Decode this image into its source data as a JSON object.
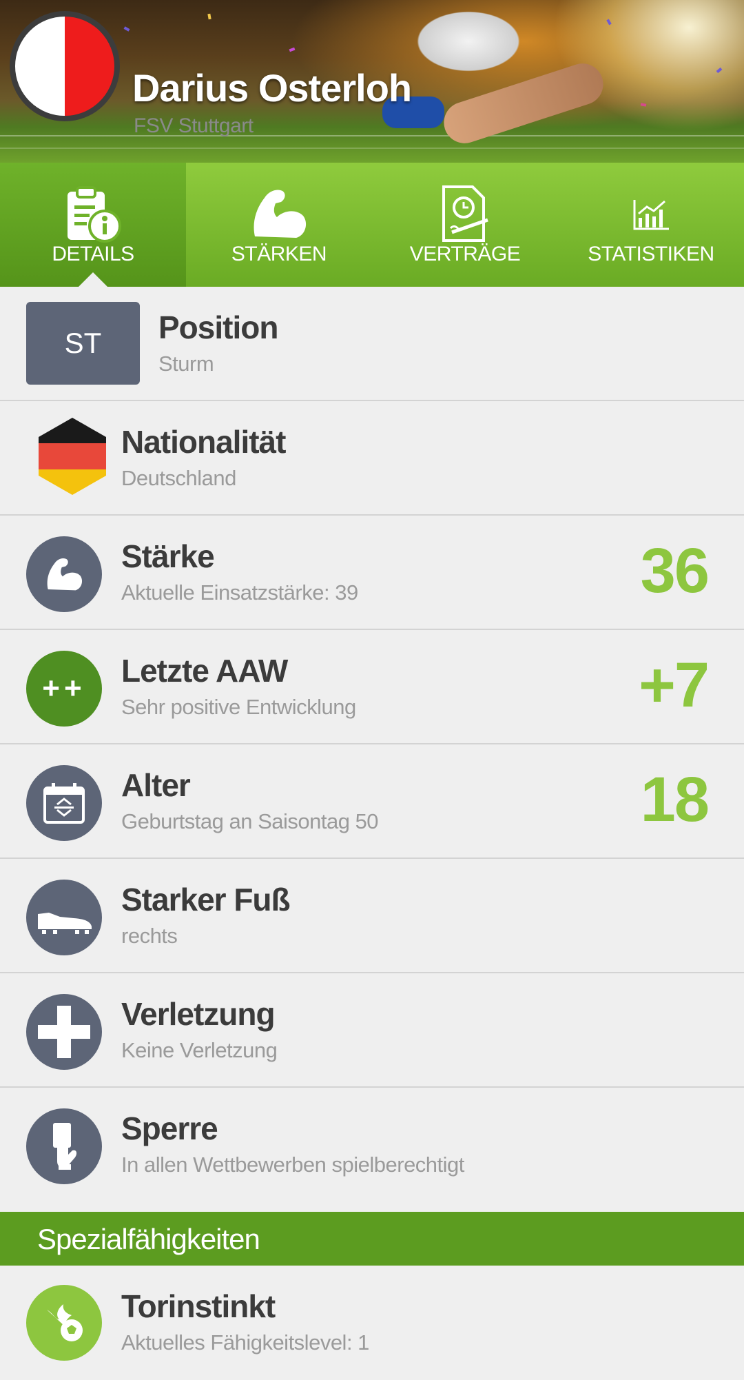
{
  "header": {
    "player_name": "Darius Osterloh",
    "club_name": "FSV Stuttgart",
    "club_colors": [
      "#ffffff",
      "#ee1c1c"
    ]
  },
  "tabs": [
    {
      "label": "DETAILS",
      "icon": "clipboard-info-icon",
      "active": true
    },
    {
      "label": "STÄRKEN",
      "icon": "biceps-icon",
      "active": false
    },
    {
      "label": "VERTRÄGE",
      "icon": "contract-clock-icon",
      "active": false
    },
    {
      "label": "STATISTIKEN",
      "icon": "bar-chart-icon",
      "active": false
    }
  ],
  "details": {
    "position": {
      "badge": "ST",
      "title": "Position",
      "subtitle": "Sturm"
    },
    "nationality": {
      "title": "Nationalität",
      "subtitle": "Deutschland",
      "icon": "germany-flag-icon"
    },
    "strength": {
      "title": "Stärke",
      "subtitle": "Aktuelle Einsatzstärke: 39",
      "value": "36",
      "icon": "biceps-icon"
    },
    "last_aaw": {
      "title": "Letzte AAW",
      "subtitle": "Sehr positive Entwicklung",
      "value": "+7",
      "badge": "++"
    },
    "age": {
      "title": "Alter",
      "subtitle": "Geburtstag an Saisontag 50",
      "value": "18",
      "icon": "calendar-icon"
    },
    "strong_foot": {
      "title": "Starker Fuß",
      "subtitle": "rechts",
      "icon": "football-boot-icon"
    },
    "injury": {
      "title": "Verletzung",
      "subtitle": "Keine Verletzung",
      "icon": "medical-cross-icon"
    },
    "suspension": {
      "title": "Sperre",
      "subtitle": "In allen Wettbewerben spielberechtigt",
      "icon": "card-hand-icon"
    }
  },
  "special_abilities": {
    "section_title": "Spezialfähigkeiten",
    "items": [
      {
        "title": "Torinstinkt",
        "subtitle": "Aktuelles Fähigkeitslevel: 1",
        "icon": "flaming-ball-icon"
      }
    ]
  },
  "colors": {
    "accent_green": "#8dc63f",
    "tab_green": "#6aab24",
    "section_green": "#5c9c20",
    "icon_slate": "#5d6577"
  }
}
